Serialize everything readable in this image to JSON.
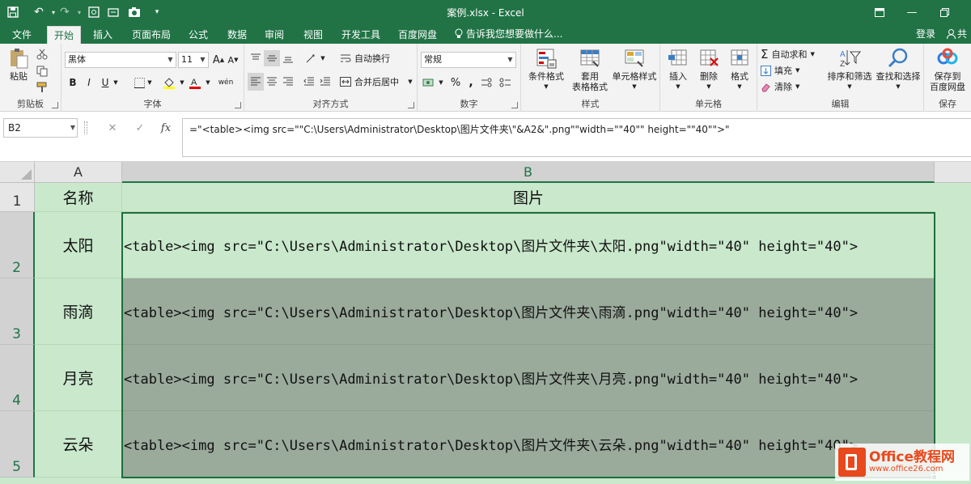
{
  "window": {
    "title": "案例.xlsx - Excel"
  },
  "tabs": [
    {
      "id": "file",
      "label": "文件"
    },
    {
      "id": "home",
      "label": "开始",
      "active": true
    },
    {
      "id": "insert",
      "label": "插入"
    },
    {
      "id": "layout",
      "label": "页面布局"
    },
    {
      "id": "formulas",
      "label": "公式"
    },
    {
      "id": "data",
      "label": "数据"
    },
    {
      "id": "review",
      "label": "审阅"
    },
    {
      "id": "view",
      "label": "视图"
    },
    {
      "id": "developer",
      "label": "开发工具"
    },
    {
      "id": "baidu",
      "label": "百度网盘"
    }
  ],
  "tell_me": "告诉我您想要做什么...",
  "login": "登录",
  "share": "共",
  "ribbon": {
    "clipboard": {
      "label": "剪贴板",
      "paste": "粘贴"
    },
    "font": {
      "label": "字体",
      "name": "黑体",
      "size": "11",
      "bold": "B",
      "italic": "I",
      "underline": "U",
      "grow": "A",
      "shrink": "A"
    },
    "alignment": {
      "label": "对齐方式",
      "wrap": "自动换行",
      "merge": "合并后居中"
    },
    "number": {
      "label": "数字",
      "format": "常规",
      "percent": "%",
      "comma": ","
    },
    "styles": {
      "label": "样式",
      "conditional": "条件格式",
      "table_line1": "套用",
      "table_line2": "表格格式",
      "cell_styles": "单元格样式"
    },
    "cells": {
      "label": "单元格",
      "insert": "插入",
      "delete": "删除",
      "format": "格式"
    },
    "editing": {
      "label": "编辑",
      "autosum": "自动求和",
      "fill": "填充",
      "clear": "清除",
      "sort": "排序和筛选",
      "find": "查找和选择"
    },
    "save": {
      "label": "保存",
      "line1": "保存到",
      "line2": "百度网盘"
    }
  },
  "formula_bar": {
    "name_box": "B2",
    "cancel": "✕",
    "enter": "✓",
    "fx": "fx",
    "formula": "=\"<table><img src=\"\"C:\\Users\\Administrator\\Desktop\\图片文件夹\\\"&A2&\".png\"\"width=\"\"40\"\" height=\"\"40\"\">\""
  },
  "sheet": {
    "columns": [
      "A",
      "B"
    ],
    "rows": [
      {
        "num": "1",
        "a": "名称",
        "b": "图片"
      },
      {
        "num": "2",
        "a": "太阳",
        "b": "<table><img src=\"C:\\Users\\Administrator\\Desktop\\图片文件夹\\太阳.png\"width=\"40\" height=\"40\">"
      },
      {
        "num": "3",
        "a": "雨滴",
        "b": "<table><img src=\"C:\\Users\\Administrator\\Desktop\\图片文件夹\\雨滴.png\"width=\"40\" height=\"40\">"
      },
      {
        "num": "4",
        "a": "月亮",
        "b": "<table><img src=\"C:\\Users\\Administrator\\Desktop\\图片文件夹\\月亮.png\"width=\"40\" height=\"40\">"
      },
      {
        "num": "5",
        "a": "云朵",
        "b": "<table><img src=\"C:\\Users\\Administrator\\Desktop\\图片文件夹\\云朵.png\"width=\"40\" height=\"40\">"
      }
    ]
  },
  "watermark": {
    "line1": "Office教程网",
    "line2": "www.office26.com"
  },
  "colors": {
    "accent": "#217346",
    "selection_fill": "#c9e8cc",
    "dark_fill": "#9aaa9b",
    "watermark": "#e8491d"
  }
}
